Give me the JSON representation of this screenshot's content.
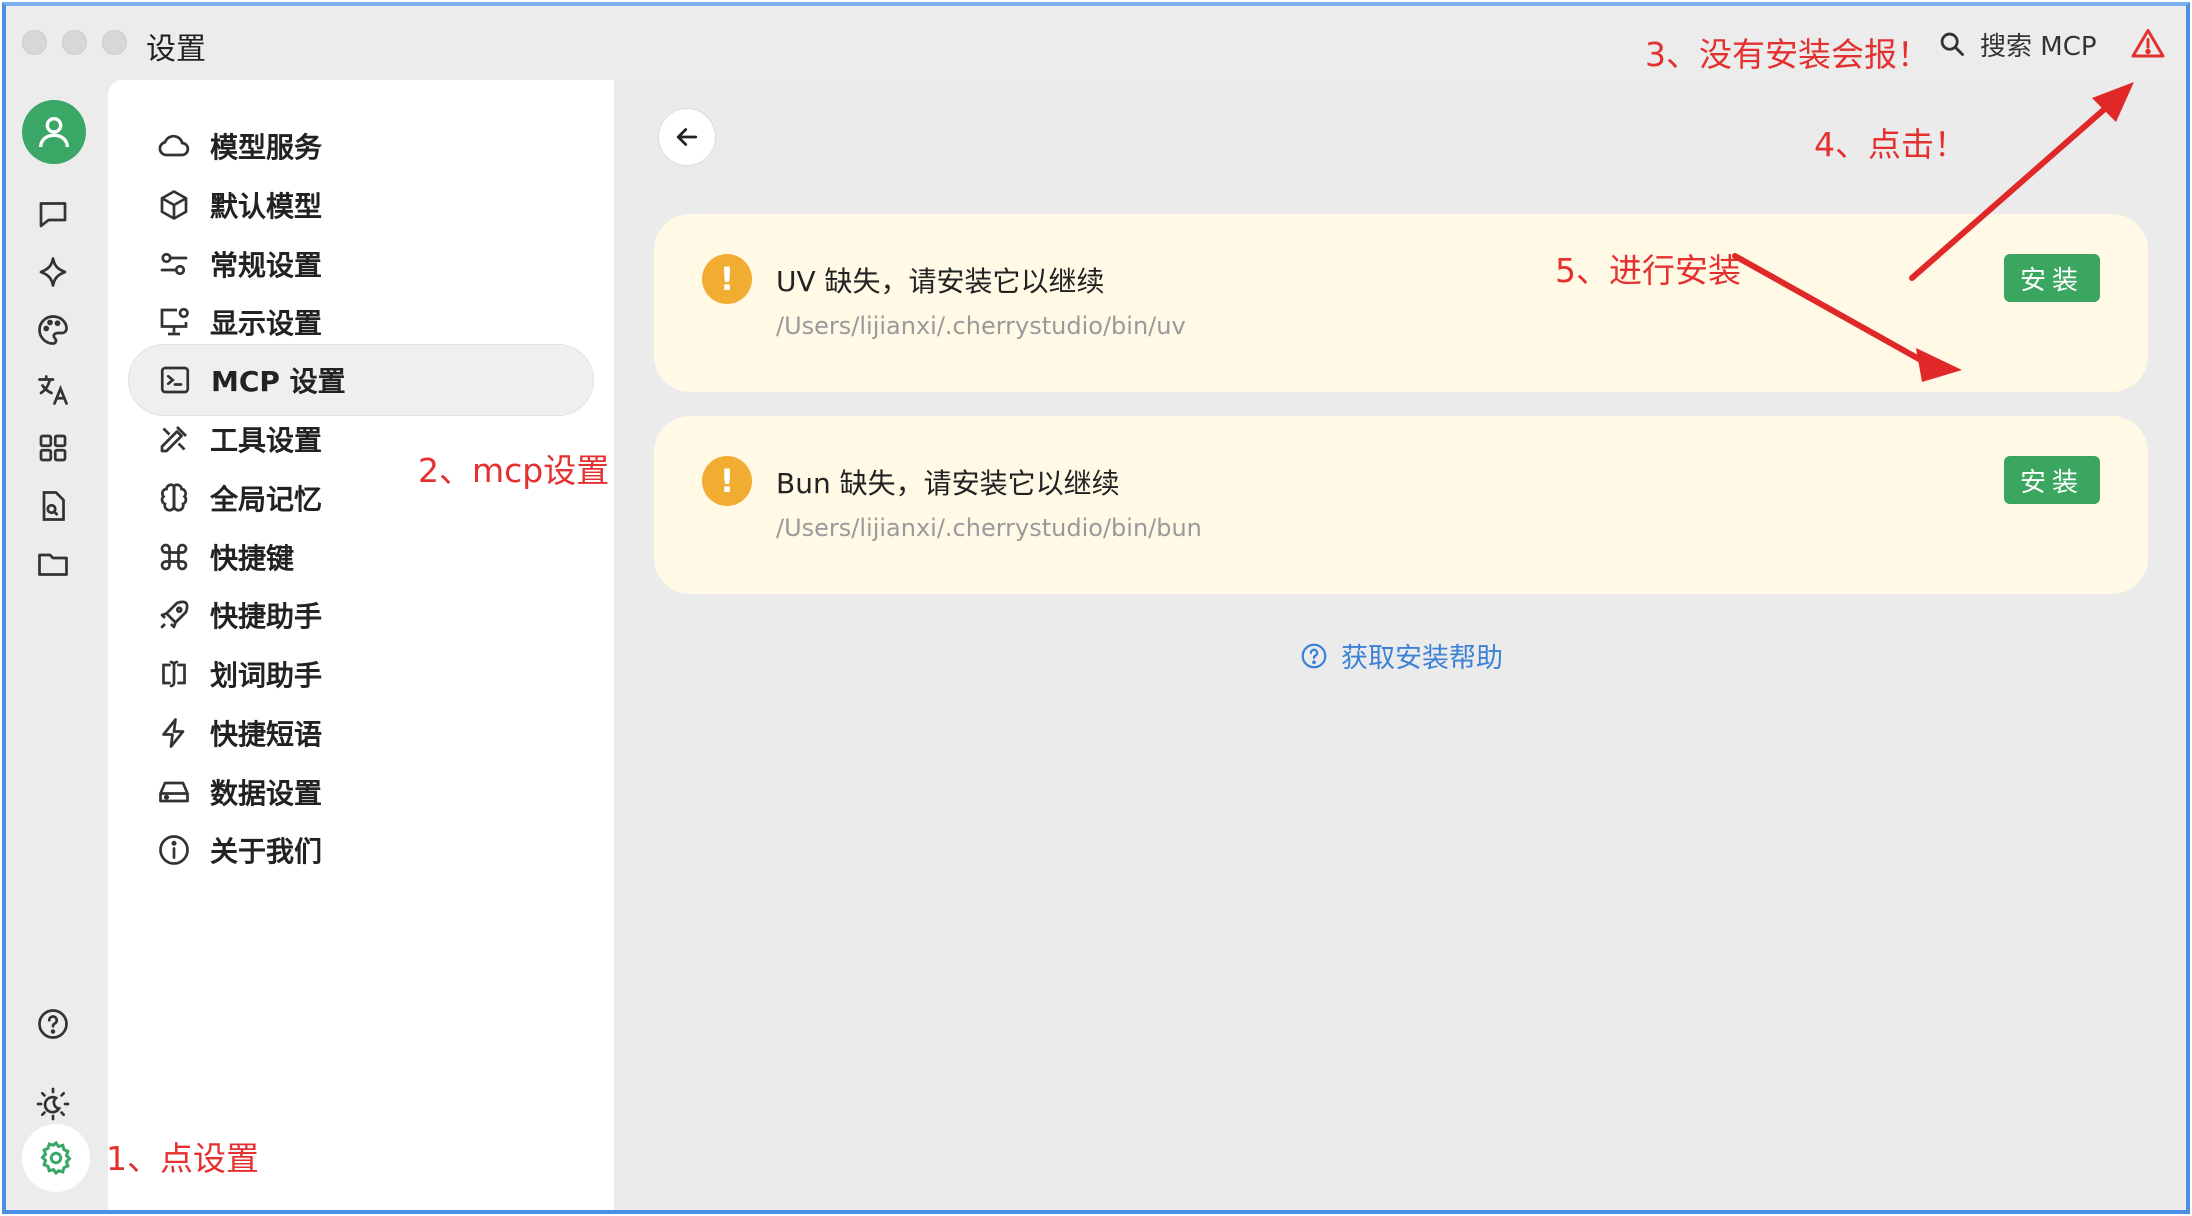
{
  "window": {
    "title": "设置"
  },
  "top_bar": {
    "search_label": "搜索 MCP"
  },
  "icon_rail": {
    "items": [
      "user-avatar-icon",
      "chat-icon",
      "sparkle-icon",
      "palette-icon",
      "translate-icon",
      "apps-grid-icon",
      "document-search-icon",
      "folder-icon"
    ],
    "bottom": [
      "help-circle-icon",
      "theme-toggle-icon",
      "settings-gear-icon"
    ]
  },
  "nav": {
    "items": [
      {
        "label": "模型服务",
        "icon": "cloud-icon"
      },
      {
        "label": "默认模型",
        "icon": "cube-icon"
      },
      {
        "label": "常规设置",
        "icon": "sliders-icon"
      },
      {
        "label": "显示设置",
        "icon": "monitor-settings-icon"
      },
      {
        "label": "MCP 设置",
        "icon": "terminal-icon",
        "active": true
      },
      {
        "label": "工具设置",
        "icon": "tools-icon"
      },
      {
        "label": "全局记忆",
        "icon": "brain-icon"
      },
      {
        "label": "快捷键",
        "icon": "command-key-icon"
      },
      {
        "label": "快捷助手",
        "icon": "rocket-icon"
      },
      {
        "label": "划词助手",
        "icon": "text-cursor-icon"
      },
      {
        "label": "快捷短语",
        "icon": "lightning-icon"
      },
      {
        "label": "数据设置",
        "icon": "storage-icon"
      },
      {
        "label": "关于我们",
        "icon": "info-icon"
      }
    ]
  },
  "main": {
    "cards": [
      {
        "title": "UV 缺失，请安装它以继续",
        "path": "/Users/lijianxi/.cherrystudio/bin/uv",
        "button": "安装"
      },
      {
        "title": "Bun 缺失，请安装它以继续",
        "path": "/Users/lijianxi/.cherrystudio/bin/bun",
        "button": "安装"
      }
    ],
    "help_link": "获取安装帮助"
  },
  "annotations": {
    "a1": "1、点设置",
    "a2": "2、mcp设置",
    "a3": "3、没有安装会报！",
    "a4": "4、点击！",
    "a5": "5、进行安装"
  },
  "colors": {
    "accent_green": "#3aa65f",
    "warning_orange": "#f0ad31",
    "card_bg": "#fff9e6",
    "annotation_red": "#e53030",
    "link_blue": "#3b82d6",
    "window_border": "#4a90e2"
  }
}
